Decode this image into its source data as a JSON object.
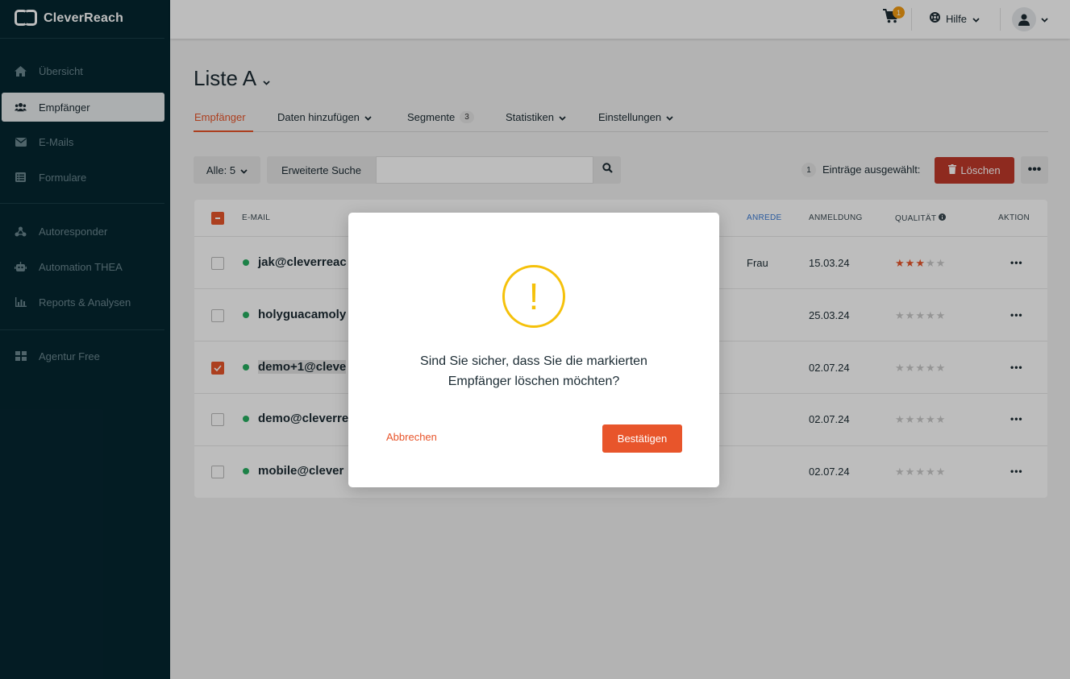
{
  "app": {
    "name": "CleverReach"
  },
  "sidebar": {
    "items": [
      {
        "label": "Übersicht",
        "icon": "home-icon"
      },
      {
        "label": "Empfänger",
        "icon": "users-icon",
        "active": true
      },
      {
        "label": "E-Mails",
        "icon": "envelope-icon"
      },
      {
        "label": "Formulare",
        "icon": "form-icon"
      },
      {
        "label": "Autoresponder",
        "icon": "autoresponder-icon"
      },
      {
        "label": "Automation THEA",
        "icon": "robot-icon"
      },
      {
        "label": "Reports & Analysen",
        "icon": "chart-icon"
      },
      {
        "label": "Agentur Free",
        "icon": "grid-icon"
      }
    ]
  },
  "topbar": {
    "cart_count": "1",
    "help_label": "Hilfe"
  },
  "page": {
    "title": "Liste A",
    "tabs": [
      {
        "label": "Empfänger",
        "active": true
      },
      {
        "label": "Daten hinzufügen"
      },
      {
        "label": "Segmente",
        "badge": "3"
      },
      {
        "label": "Statistiken"
      },
      {
        "label": "Einstellungen"
      }
    ]
  },
  "toolbar": {
    "filter_label": "Alle: 5",
    "advanced_search_label": "Erweiterte Suche",
    "search_value": "",
    "selected_count": "1",
    "selected_text": "Einträge ausgewählt:",
    "delete_label": "Löschen"
  },
  "table": {
    "headers": {
      "email": "E-MAIL",
      "anrede": "ANREDE",
      "anmeldung": "ANMELDUNG",
      "qualitaet": "QUALITÄT",
      "aktion": "AKTION"
    },
    "rows": [
      {
        "email": "jak@cleverreac",
        "anrede": "Frau",
        "date": "15.03.24",
        "rating": 3,
        "checked": false
      },
      {
        "email": "holyguacamoly",
        "anrede": "",
        "date": "25.03.24",
        "rating": 0,
        "checked": false
      },
      {
        "email": "demo+1@cleve",
        "anrede": "",
        "date": "02.07.24",
        "rating": 0,
        "checked": true
      },
      {
        "email": "demo@cleverre",
        "anrede": "",
        "date": "02.07.24",
        "rating": 0,
        "checked": false
      },
      {
        "email": "mobile@clever",
        "anrede": "",
        "date": "02.07.24",
        "rating": 0,
        "checked": false
      }
    ],
    "action_glyph": "•••"
  },
  "dialog": {
    "icon_glyph": "!",
    "message_line1": "Sind Sie sicher, dass Sie die markierten",
    "message_line2": "Empfänger löschen möchten?",
    "cancel_label": "Abbrechen",
    "confirm_label": "Bestätigen"
  },
  "colors": {
    "sidebar_bg": "#052630",
    "accent": "#e8552b",
    "danger": "#c0392b",
    "warning": "#f5c10a",
    "status_active": "#27ae60"
  }
}
